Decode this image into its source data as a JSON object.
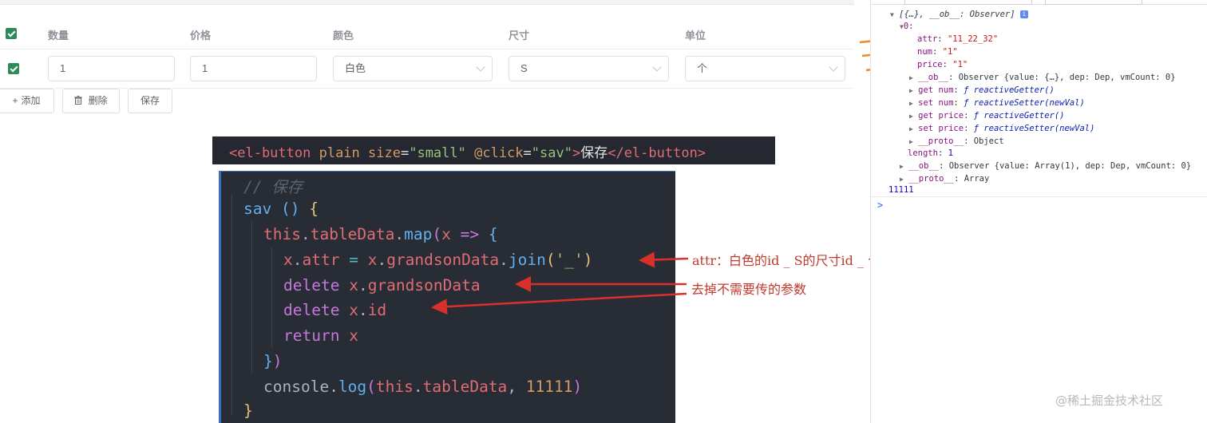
{
  "table": {
    "headers": [
      "数量",
      "价格",
      "颜色",
      "尺寸",
      "单位"
    ],
    "row": {
      "quantity": "1",
      "price": "1",
      "color": "白色",
      "size": "S",
      "unit": "个"
    },
    "buttons": {
      "add": "添加",
      "delete": "删除",
      "save": "保存"
    },
    "checkbox_color": "#409eff"
  },
  "strip": {
    "open_tag": "<el-button",
    "attr_plain": " plain",
    "attr_size": " size",
    "eq1": "=",
    "size_val": "\"small\"",
    "attr_click": " @click",
    "eq2": "=",
    "click_val": "\"sav\"",
    "close_open": ">",
    "text": "保存",
    "end_tag": "</el-button>"
  },
  "editor": {
    "l1": "// 保存",
    "l2_fn": "sav",
    "l2_rest": " () ",
    "l2_br": "{",
    "l3_this": "this",
    "l3_dot": ".",
    "l3_prop": "tableData",
    "l3_dot2": ".",
    "l3_map": "map",
    "l3_p": "(",
    "l3_x": "x",
    "l3_arrow": " => ",
    "l3_br": "{",
    "l4_x": "x",
    "l4_dot": ".",
    "l4_attr": "attr",
    "l4_eq": " = ",
    "l4_x2": "x",
    "l4_dot2": ".",
    "l4_gd": "grandsonData",
    "l4_dot3": ".",
    "l4_join": "join",
    "l4_p": "(",
    "l4_str": "'_'",
    "l4_p2": ")",
    "l5_kw": "delete",
    "l5_x": " x",
    "l5_dot": ".",
    "l5_gd": "grandsonData",
    "l6_kw": "delete",
    "l6_x": " x",
    "l6_dot": ".",
    "l6_id": "id",
    "l7_kw": "return",
    "l7_x": " x",
    "l8_br": "}",
    "l8_p": ")",
    "l9_console": "console",
    "l9_dot": ".",
    "l9_log": "log",
    "l9_p": "(",
    "l9_this": "this",
    "l9_dot2": ".",
    "l9_td": "tableData",
    "l9_comma": ", ",
    "l9_num": "11111",
    "l9_p2": ")",
    "l10_br": "}"
  },
  "annotations": {
    "attr_note": "attr：白色的id _ S的尺寸id _ 个的id拼接",
    "remove_note": "去掉不需要传的参数",
    "arrow_color": "#d9302c",
    "orange_arrow_color": "#f08a24"
  },
  "console": {
    "l0": "[{…}, __ob__: Observer]",
    "l1": "0:",
    "attr_key": "attr",
    "attr_val": "\"11_22_32\"",
    "num_key": "num",
    "num_val": "\"1\"",
    "price_key": "price",
    "price_val": "\"1\"",
    "ob_line_key": "__ob__",
    "ob_line_val": ": Observer {value: {…}, dep: Dep, vmCount: 0}",
    "get_num_key": "get num",
    "get_num_val": "ƒ reactiveGetter()",
    "set_num_key": "set num",
    "set_num_val": "ƒ reactiveSetter(newVal)",
    "get_price_key": "get price",
    "get_price_val": "ƒ reactiveGetter()",
    "set_price_key": "set price",
    "set_price_val": "ƒ reactiveSetter(newVal)",
    "proto_key": "__proto__",
    "proto_val": ": Object",
    "length_key": "length",
    "length_val": "1",
    "ob2_key": "__ob__",
    "ob2_val": ": Observer {value: Array(1), dep: Dep, vmCount: 0}",
    "proto2_key": "__proto__",
    "proto2_val": ": Array",
    "logged": "11111",
    "prompt": ">"
  },
  "watermark": "@稀土掘金技术社区"
}
